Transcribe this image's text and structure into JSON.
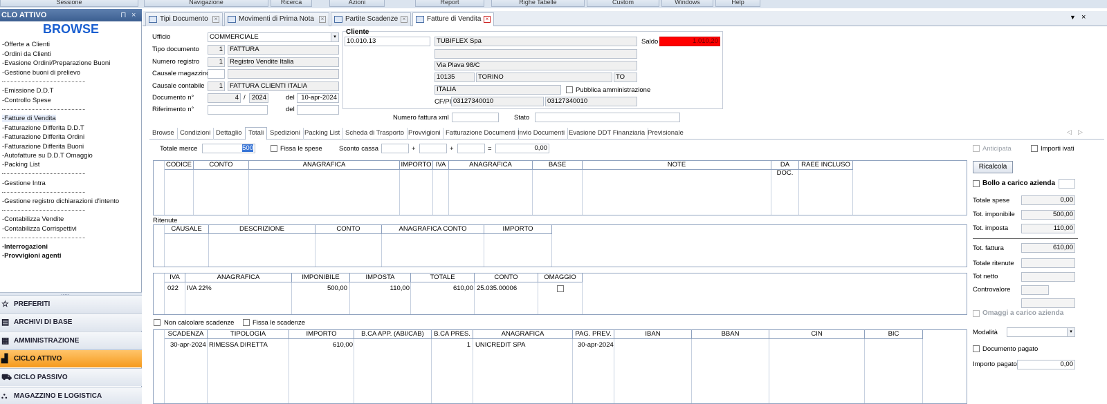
{
  "menu": [
    "Sessione",
    "Navigazione",
    "Ricerca",
    "Azioni",
    "Report",
    "Righe Tabelle",
    "Custom",
    "Windows",
    "Help"
  ],
  "left": {
    "title": "CLO ATTIVO",
    "pin": "⊓",
    "close": "×",
    "browse": "BROWSE",
    "items": [
      "Offerte a Clienti",
      "Ordini da Clienti",
      "Evasione Ordini/Preparazione Buoni",
      "Gestione buoni di prelievo",
      "Emissione D.D.T",
      "Controllo Spese",
      "Fatture di Vendita",
      "Fatturazione Differita D.D.T",
      "Fatturazione Differita  Ordini",
      "Fatturazione Differita Buoni",
      "Autofatture su D.D.T Omaggio",
      "Packing List",
      "Gestione Intra",
      "Gestione registro dichiarazioni d'intento",
      "Contabilizza Vendite",
      "Contabilizza Corrispettivi",
      "Interrogazioni",
      "Provvigioni agenti"
    ],
    "splitter": ".....",
    "sections": [
      "PREFERITI",
      "ARCHIVI DI BASE",
      "AMMINISTRAZIONE",
      "CICLO ATTIVO",
      "CICLO PASSIVO",
      "MAGAZZINO E LOGISTICA"
    ]
  },
  "tabs": [
    "Tipi Documento",
    "Movimenti di Prima Nota",
    "Partite Scadenze",
    "Fatture di Vendita"
  ],
  "tab_controls": {
    "dropdown": "▼",
    "close": "×"
  },
  "form": {
    "ufficio_label": "Ufficio",
    "ufficio": "COMMERCIALE",
    "tipo_doc_label": "Tipo documento",
    "tipo_doc_code": "1",
    "tipo_doc": "FATTURA",
    "num_reg_label": "Numero registro",
    "num_reg_code": "1",
    "num_reg": "Registro Vendite Italia",
    "caus_mag_label": "Causale magazzino",
    "caus_cont_label": "Causale contabile",
    "caus_cont_code": "1",
    "caus_cont": "FATTURA CLIENTI ITALIA",
    "doc_n_label": "Documento n°",
    "doc_n": "4",
    "slash": "/",
    "doc_year": "2024",
    "del_label": "del",
    "doc_date": "10-apr-2024",
    "rif_label": "Riferimento n°",
    "rif_del_label": "del"
  },
  "cliente": {
    "title": "Cliente",
    "code": "10.010.13",
    "name": "TUBIFLEX Spa",
    "address": "Via Plava 98/C",
    "cap": "10135",
    "city": "TORINO",
    "prov": "TO",
    "country": "ITALIA",
    "pa_label": "Pubblica amministrazione",
    "cfpi_label": "CF/PI",
    "cf": "03127340010",
    "pi": "03127340010",
    "saldo_label": "Saldo",
    "saldo": "1.010,20"
  },
  "xml": {
    "label": "Numero fattura xml",
    "stato_label": "Stato"
  },
  "subtabs": [
    "Browse",
    "Condizioni",
    "Dettaglio",
    "Totali",
    "Spedizioni",
    "Packing List",
    "Scheda di Trasporto",
    "Provvigioni",
    "Fatturazione Documenti",
    "Invio Documenti",
    "Evasione DDT Finanziaria",
    "Previsionale"
  ],
  "subtab_arrows": {
    "left": "◁",
    "right": "▷"
  },
  "totali": {
    "merce_label": "Totale merce",
    "merce": "500",
    "fissa_spese": "Fissa le spese",
    "sconto_label": "Sconto cassa",
    "plus": "+",
    "eq": "=",
    "sconto_total": "0,00"
  },
  "grid1": {
    "headers": [
      "CODICE",
      "CONTO",
      "ANAGRAFICA",
      "IMPORTO",
      "IVA",
      "ANAGRAFICA",
      "BASE",
      "NOTE",
      "DA DOC.",
      "RAEE INCLUSO"
    ]
  },
  "ritenute": {
    "label": "Ritenute",
    "headers": [
      "CAUSALE",
      "DESCRIZIONE",
      "CONTO",
      "ANAGRAFICA CONTO",
      "IMPORTO"
    ]
  },
  "iva": {
    "headers": [
      "IVA",
      "ANAGRAFICA",
      "IMPONIBILE",
      "IMPOSTA",
      "TOTALE",
      "CONTO",
      "OMAGGIO"
    ],
    "rows": [
      {
        "iva": "022",
        "anag": "IVA 22%",
        "imponibile": "500,00",
        "imposta": "110,00",
        "totale": "610,00",
        "conto": "25.035.00006"
      }
    ]
  },
  "scad_opts": {
    "non_calc": "Non calcolare scadenze",
    "fissa": "Fissa le scadenze"
  },
  "scadenze": {
    "headers": [
      "SCADENZA",
      "TIPOLOGIA",
      "IMPORTO",
      "B.CA APP. (ABI/CAB)",
      "B.CA PRES.",
      "ANAGRAFICA",
      "PAG. PREV.",
      "IBAN",
      "BBAN",
      "CIN",
      "BIC"
    ],
    "rows": [
      {
        "scadenza": "30-apr-2024",
        "tipologia": "RIMESSA DIRETTA",
        "importo": "610,00",
        "bca_pres": "1",
        "anag": "UNICREDIT SPA",
        "pag_prev": "30-apr-2024"
      }
    ]
  },
  "right": {
    "anticipata": "Anticipata",
    "importi_ivati": "Importi ivati",
    "ricalcola": "Ricalcola",
    "bollo": "Bollo a carico azienda",
    "tot_spese_label": "Totale spese",
    "tot_spese": "0,00",
    "tot_imp_label": "Tot. imponibile",
    "tot_imp": "500,00",
    "tot_imposta_label": "Tot. imposta",
    "tot_imposta": "110,00",
    "tot_fatt_label": "Tot. fattura",
    "tot_fatt": "610,00",
    "tot_rit_label": "Totale ritenute",
    "tot_netto_label": "Tot netto",
    "controvalore_label": "Controvalore",
    "omaggi": "Omaggi a carico azienda",
    "modalita_label": "Modalità",
    "doc_pagato": "Documento pagato",
    "imp_pagato_label": "Importo pagato",
    "imp_pagato": "0,00"
  },
  "colors": {
    "accent": "#f59a1c",
    "saldo_bg": "#ff0000",
    "brand": "#1a5fd0"
  }
}
